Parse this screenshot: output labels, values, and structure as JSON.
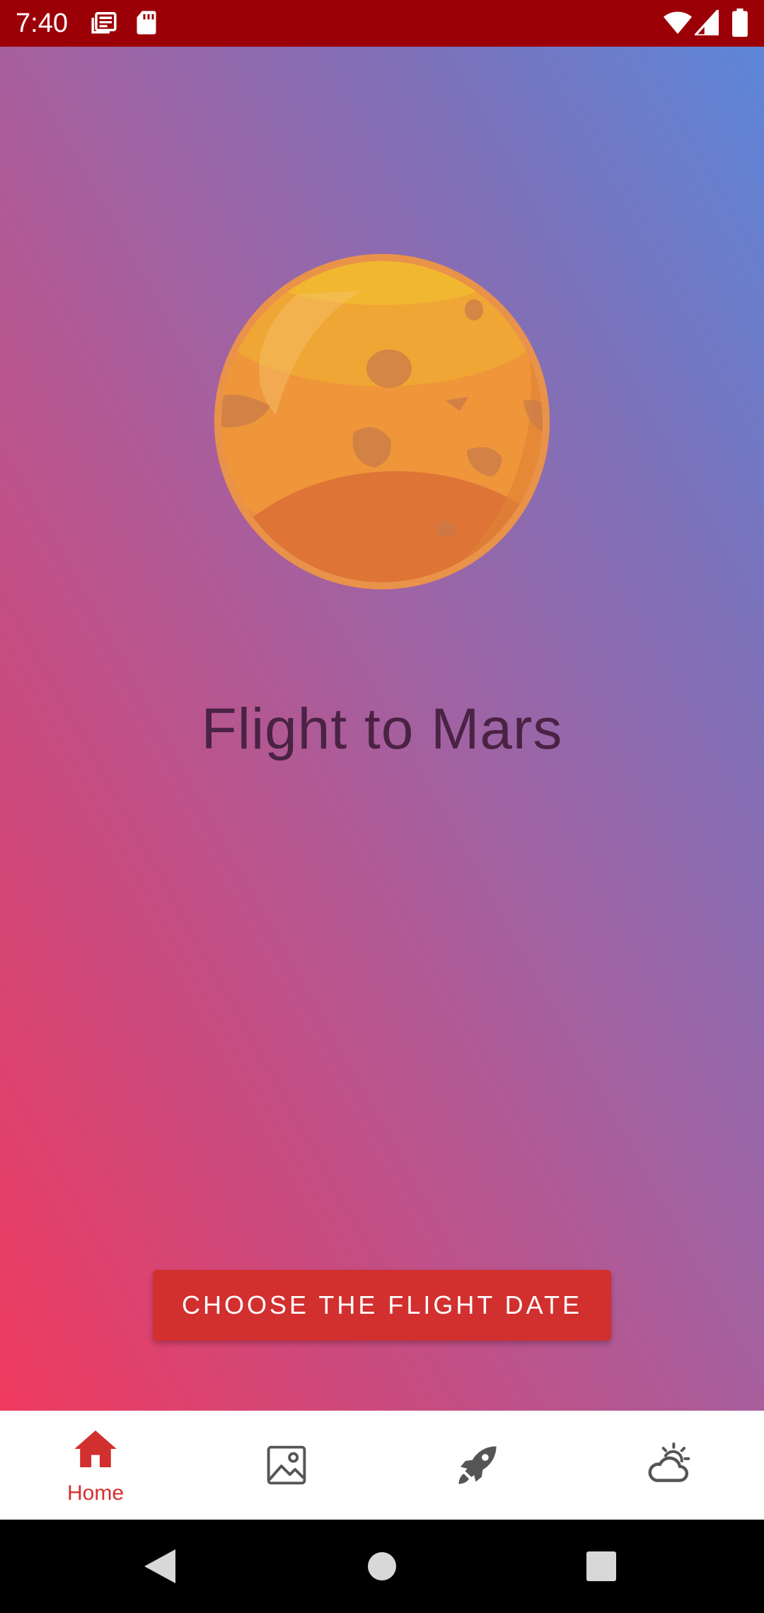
{
  "status_bar": {
    "time": "7:40",
    "left_icons": [
      "news-icon",
      "sd-card-icon"
    ],
    "right_icons": [
      "wifi-icon",
      "cellular-signal-icon",
      "battery-icon"
    ],
    "background": "#9c0007"
  },
  "main": {
    "title": "Flight to Mars",
    "cta_label": "CHOOSE THE FLIGHT DATE",
    "planet_icon": "mars-planet-icon",
    "gradient": [
      "#ef3a5e",
      "#5d86d8"
    ],
    "accent": "#d22f2f"
  },
  "bottom_nav": {
    "items": [
      {
        "icon": "home-icon",
        "label": "Home",
        "selected": true
      },
      {
        "icon": "image-icon",
        "label": "",
        "selected": false
      },
      {
        "icon": "rocket-icon",
        "label": "",
        "selected": false
      },
      {
        "icon": "weather-icon",
        "label": "",
        "selected": false
      }
    ]
  },
  "system_nav": {
    "buttons": [
      "back-icon",
      "home-circle-icon",
      "recents-icon"
    ]
  }
}
